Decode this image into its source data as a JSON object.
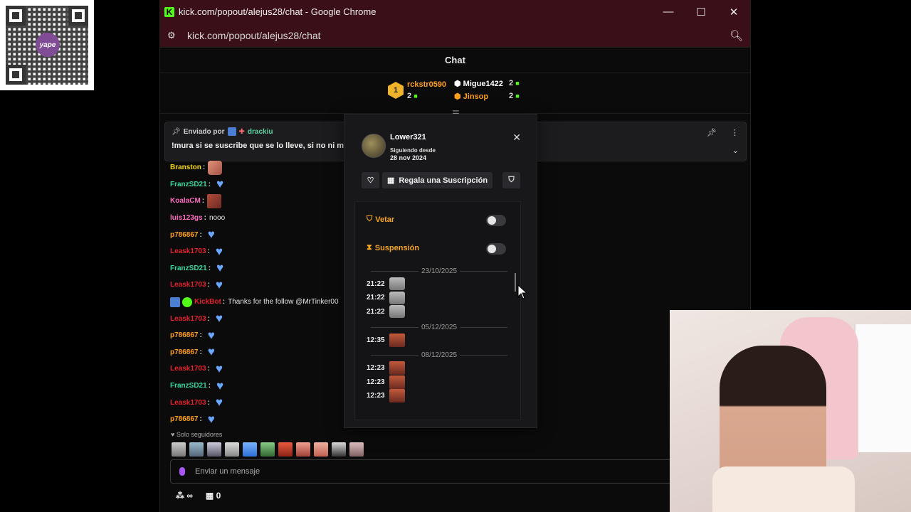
{
  "window": {
    "title": "kick.com/popout/alejus28/chat - Google Chrome",
    "url": "kick.com/popout/alejus28/chat",
    "controls": {
      "minimize": "—",
      "maximize": "☐",
      "close": "✕"
    }
  },
  "chat": {
    "header": "Chat",
    "leaderboard": [
      {
        "rank": "1",
        "user": "rckstr0590",
        "count": "2"
      },
      {
        "user": "Migue1422",
        "count": "2"
      },
      {
        "user": "Jinsop",
        "count": "2"
      }
    ],
    "pinned": {
      "sent_by_label": "Enviado por",
      "sender": "drackiu",
      "message": "!mura si se suscribe que se lo lleve, si no ni mie"
    },
    "messages": [
      {
        "user": "Branston",
        "color": "#f5d90a",
        "text": "",
        "emote": "hand"
      },
      {
        "user": "FranzSD21",
        "color": "#33d9a0",
        "text": "",
        "emote": "heart"
      },
      {
        "user": "KoalaCM",
        "color": "#ff6bc1",
        "text": "",
        "emote": "face"
      },
      {
        "user": "luis123gs",
        "color": "#ff6bc1",
        "text": "nooo",
        "emote": ""
      },
      {
        "user": "p786867",
        "color": "#ff9f1c",
        "text": "",
        "emote": "heart"
      },
      {
        "user": "Leask1703",
        "color": "#e8212d",
        "text": "",
        "emote": "heart"
      },
      {
        "user": "FranzSD21",
        "color": "#33d9a0",
        "text": "",
        "emote": "heart"
      },
      {
        "user": "Leask1703",
        "color": "#e8212d",
        "text": "",
        "emote": "heart"
      },
      {
        "user": "KickBot",
        "color": "#e8212d",
        "text": "Thanks for the follow @MrTinker00",
        "emote": "",
        "bot": true
      },
      {
        "user": "Leask1703",
        "color": "#e8212d",
        "text": "",
        "emote": "heart"
      },
      {
        "user": "p786867",
        "color": "#ff9f1c",
        "text": "",
        "emote": "heart"
      },
      {
        "user": "p786867",
        "color": "#ff9f1c",
        "text": "",
        "emote": "heart"
      },
      {
        "user": "Leask1703",
        "color": "#e8212d",
        "text": "",
        "emote": "heart"
      },
      {
        "user": "FranzSD21",
        "color": "#33d9a0",
        "text": "",
        "emote": "heart"
      },
      {
        "user": "Leask1703",
        "color": "#e8212d",
        "text": "",
        "emote": "heart"
      },
      {
        "user": "p786867",
        "color": "#ff9f1c",
        "text": "",
        "emote": "heart"
      }
    ],
    "followers_only": "Solo seguidores",
    "input_placeholder": "Enviar un mensaje",
    "bottom": {
      "infinity": "∞",
      "gift_count": "0"
    }
  },
  "user_card": {
    "username": "Lower321",
    "following_since_label": "Siguiendo desde",
    "following_since_date": "28 nov 2024",
    "gift_sub_button": "Regala una Suscripción",
    "ban_label": "Vetar",
    "timeout_label": "Suspensión",
    "history": [
      {
        "date": "23/10/2025",
        "entries": [
          {
            "time": "21:22",
            "emote": "cat"
          },
          {
            "time": "21:22",
            "emote": "cat"
          },
          {
            "time": "21:22",
            "emote": "cat"
          }
        ]
      },
      {
        "date": "05/12/2025",
        "entries": [
          {
            "time": "12:35",
            "emote": "face"
          }
        ]
      },
      {
        "date": "08/12/2025",
        "entries": [
          {
            "time": "12:23",
            "emote": "face"
          },
          {
            "time": "12:23",
            "emote": "face"
          },
          {
            "time": "12:23",
            "emote": "face"
          }
        ]
      }
    ]
  },
  "overlay": {
    "qr_brand": "yape"
  }
}
